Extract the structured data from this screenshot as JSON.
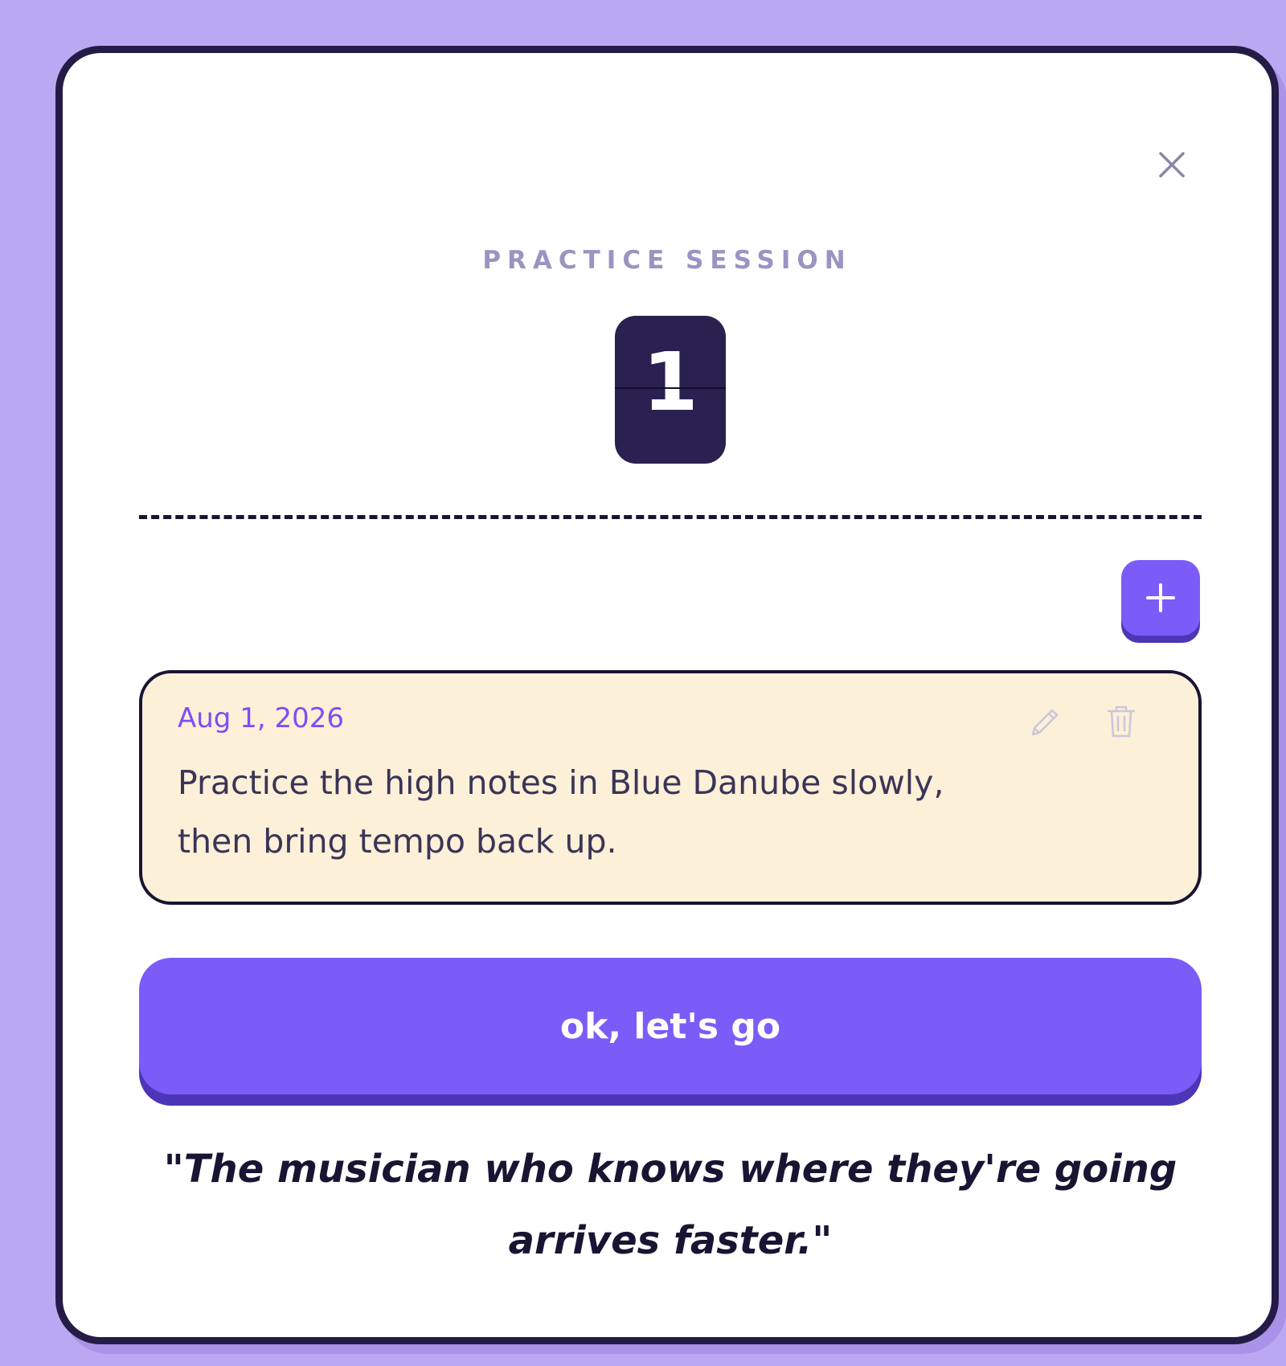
{
  "modal": {
    "close_icon": "close-icon",
    "section_label": "PRACTICE SESSION",
    "session_number": "1",
    "add_icon": "plus-icon",
    "note": {
      "date": "Aug 1, 2026",
      "text": "Practice the high notes in Blue Danube slowly, then bring tempo back up.",
      "edit_icon": "pencil-icon",
      "delete_icon": "trash-icon"
    },
    "cta_label": "ok, let's go",
    "quote": "\"The musician who knows where they're going arrives faster.\""
  },
  "colors": {
    "background": "#bba8f2",
    "accent": "#7b5cf8",
    "accent_shadow": "#4d35b8",
    "dark": "#241c46",
    "note_background": "#fdf0d8",
    "date_text": "#7b4ef8",
    "label_text": "#9a94c2"
  }
}
